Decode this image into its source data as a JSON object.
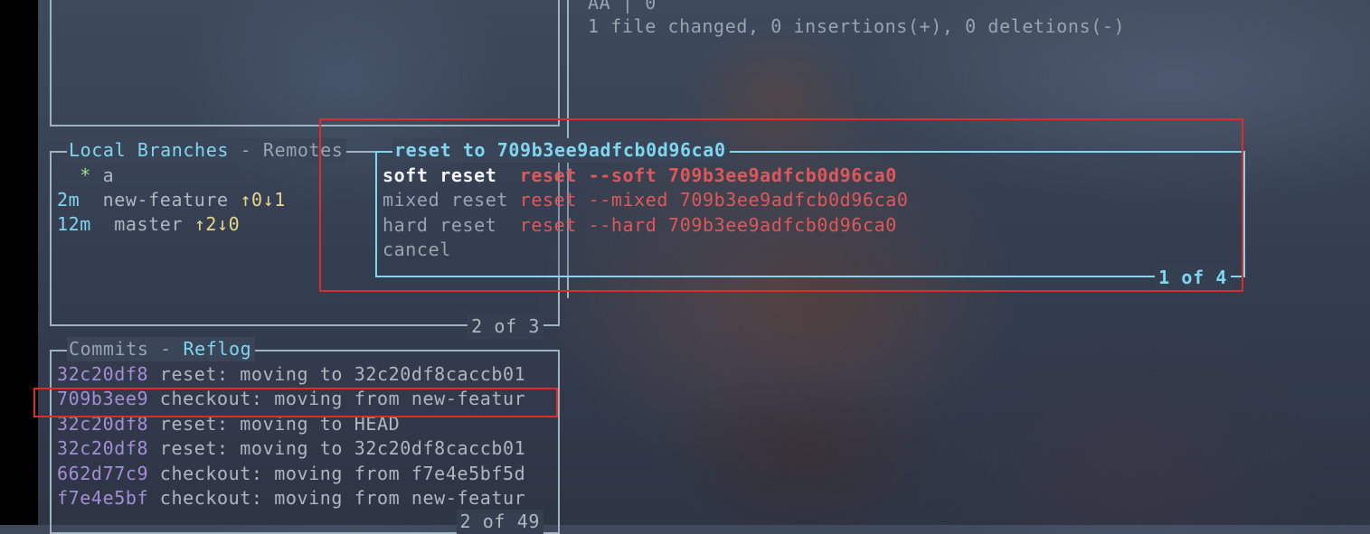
{
  "diff_pane": {
    "partial_line": "AA | 0",
    "summary": "1 file changed, 0 insertions(+), 0 deletions(-)"
  },
  "branches_panel": {
    "title_local": "Local Branches",
    "title_sep": " - ",
    "title_remotes": "Remotes",
    "footer": "2 of 3",
    "items": [
      {
        "age": "",
        "marker": "*",
        "name": "a",
        "status": ""
      },
      {
        "age": "2m",
        "marker": "",
        "name": "new-feature",
        "status": "↑0↓1"
      },
      {
        "age": "12m",
        "marker": "",
        "name": "master",
        "status": "↑2↓0"
      }
    ]
  },
  "commits_panel": {
    "title_commits": "Commits",
    "title_sep": " - ",
    "title_reflog": "Reflog",
    "footer": "2 of 49",
    "rows": [
      {
        "hash": "32c20df8",
        "message": "reset: moving to 32c20df8caccb01"
      },
      {
        "hash": "709b3ee9",
        "message": "checkout: moving from new-featur"
      },
      {
        "hash": "32c20df8",
        "message": "reset: moving to HEAD"
      },
      {
        "hash": "32c20df8",
        "message": "reset: moving to 32c20df8caccb01"
      },
      {
        "hash": "662d77c9",
        "message": "checkout: moving from f7e4e5bf5d"
      },
      {
        "hash": "f7e4e5bf",
        "message": "checkout: moving from new-featur"
      }
    ]
  },
  "reset_menu": {
    "title": "reset to 709b3ee9adfcb0d96ca0",
    "footer": "1 of 4",
    "options": [
      {
        "label": "soft reset ",
        "command": "reset --soft 709b3ee9adfcb0d96ca0"
      },
      {
        "label": "mixed reset",
        "command": "reset --mixed 709b3ee9adfcb0d96ca0"
      },
      {
        "label": "hard reset ",
        "command": "reset --hard 709b3ee9adfcb0d96ca0"
      },
      {
        "label": "cancel",
        "command": ""
      }
    ]
  },
  "colors": {
    "border": "#9fb2c4",
    "active_border": "#7fd6f0",
    "hash": "#a48ed6",
    "command": "#e0575a",
    "annotation": "#e22a26"
  }
}
